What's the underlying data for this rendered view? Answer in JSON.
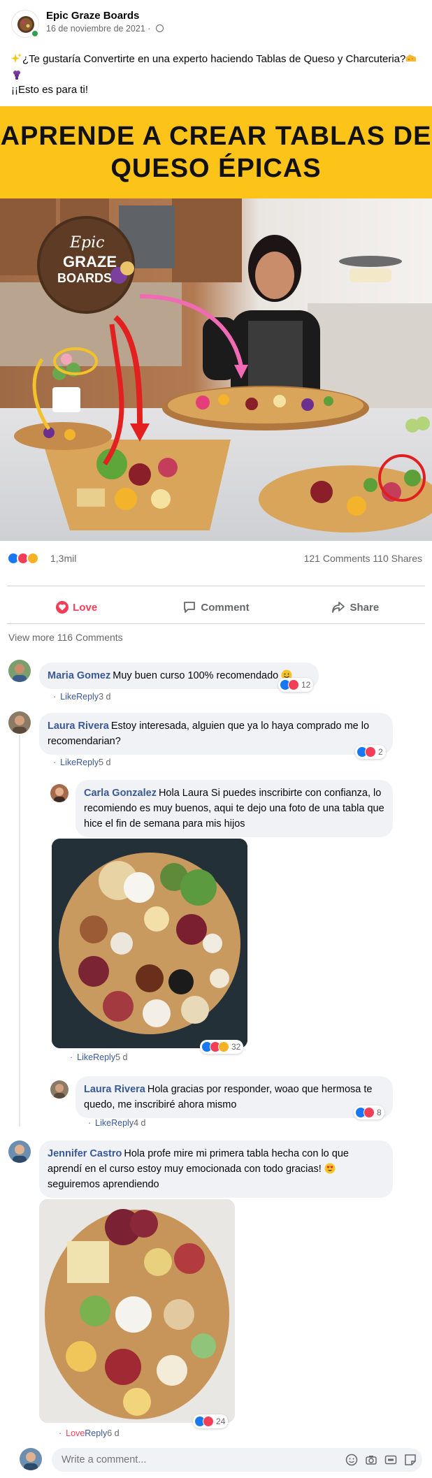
{
  "post": {
    "page_name": "Epic Graze Boards",
    "date": "16 de noviembre de 2021",
    "text_line1": "¿Te gustaría Convertirte en una experto haciendo Tablas de Queso y Charcuteria?",
    "text_line2": "¡¡Esto es para ti!",
    "banner_line1": "APRENDE A CREAR TABLAS DE",
    "banner_line2": "QUESO ÉPICAS",
    "logo_line1": "Epic",
    "logo_line2": "GRAZE",
    "logo_line3": "BOARDS"
  },
  "reactions": {
    "count": "1,3mil",
    "comments": "121 Comments",
    "shares": "110 Shares"
  },
  "actions": {
    "love": "Love",
    "comment": "Comment",
    "share": "Share"
  },
  "comments_section": {
    "view_more": "View more 116 Comments",
    "write_placeholder": "Write a comment..."
  },
  "comments": [
    {
      "name": "Maria Gomez",
      "text": "Muy buen curso 100% recomendado",
      "like": "Like",
      "reply": "Reply",
      "time": "3 d",
      "reactions": "12"
    },
    {
      "name": "Laura Rivera",
      "text": "Estoy interesada, alguien que ya lo haya comprado me lo recomendarian?",
      "like": "Like",
      "reply": "Reply",
      "time": "5 d",
      "reactions": "2"
    },
    {
      "name": "Carla Gonzalez",
      "text": "Hola Laura Si puedes inscribirte con confianza, lo recomiendo es muy buenos, aqui te dejo una foto de una tabla que hice el fin de semana para mis hijos",
      "like": "Like",
      "reply": "Reply",
      "time": "5 d",
      "reactions": "32"
    },
    {
      "name": "Laura Rivera",
      "text": "Hola gracias por responder, woao que hermosa te quedo, me inscribiré ahora mismo",
      "like": "Like",
      "reply": "Reply",
      "time": "4 d",
      "reactions": "8"
    },
    {
      "name": "Jennifer Castro",
      "text": "Hola profe mire mi primera tabla hecha con lo que aprendí en el curso estoy muy emocionada con todo gracias!",
      "text2": "seguiremos aprendiendo",
      "like": "Love",
      "reply": "Reply",
      "time": "6 d",
      "reactions": "24"
    }
  ],
  "colors": {
    "banner": "#fcc418",
    "link_blue": "#385898",
    "love_red": "#f33e58",
    "like_blue": "#1877f2"
  }
}
